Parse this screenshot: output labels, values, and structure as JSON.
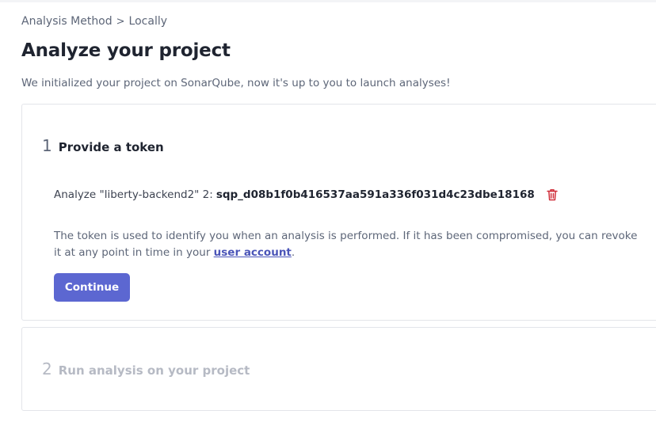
{
  "breadcrumb": {
    "items": [
      "Analysis Method",
      "Locally"
    ],
    "separator": ">"
  },
  "page": {
    "title": "Analyze your project",
    "subtitle": "We initialized your project on SonarQube, now it's up to you to launch analyses!"
  },
  "steps": [
    {
      "number": "1",
      "title": "Provide a token",
      "token_label": "Analyze \"liberty-backend2\" 2:",
      "token_value": "sqp_d08b1f0b416537aa591a336f031d4c23dbe18168",
      "delete_icon": "trash-icon",
      "description_before": "The token is used to identify you when an analysis is performed. If it has been compromised, you can revoke it at any point in time in your ",
      "description_link": "user account",
      "description_after": ".",
      "continue_label": "Continue"
    },
    {
      "number": "2",
      "title": "Run analysis on your project"
    }
  ],
  "colors": {
    "accent": "#5c67d1",
    "link": "#4b55b8",
    "danger": "#d02f3a",
    "muted": "#b6bac4"
  }
}
